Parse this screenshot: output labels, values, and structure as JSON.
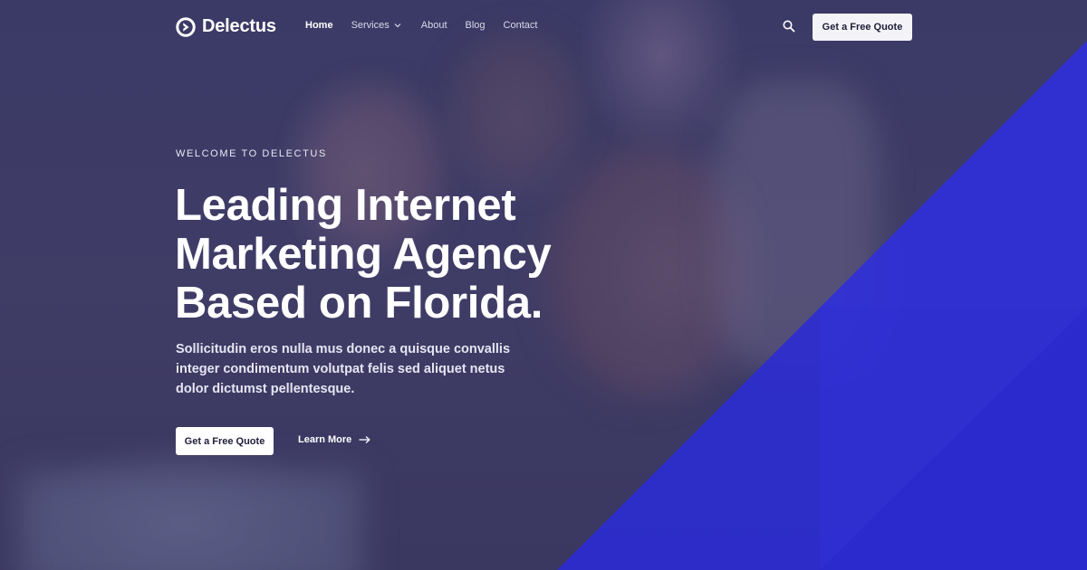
{
  "brand": {
    "name": "Delectus",
    "logo_icon": "play-circle-icon"
  },
  "nav": {
    "items": [
      {
        "label": "Home",
        "active": true
      },
      {
        "label": "Services",
        "has_dropdown": true
      },
      {
        "label": "About"
      },
      {
        "label": "Blog"
      },
      {
        "label": "Contact"
      }
    ],
    "search_icon": "search-icon",
    "quote_button": "Get a Free Quote"
  },
  "hero": {
    "eyebrow": "WELCOME TO DELECTUS",
    "headline_lines": [
      "Leading Internet",
      "Marketing Agency",
      "Based on Florida."
    ],
    "description": "Sollicitudin eros nulla mus donec a quisque convallis integer condimentum volutpat felis sed aliquet netus dolor dictumst pellentesque.",
    "primary_cta": "Get a Free Quote",
    "secondary_cta": "Learn More",
    "secondary_cta_icon": "arrow-right-icon"
  },
  "colors": {
    "overlay": "#3d3a66",
    "accent_blue": "#2f2fd9",
    "text_white": "#ffffff",
    "button_bg": "#ffffff",
    "button_text": "#1f1e3a"
  }
}
